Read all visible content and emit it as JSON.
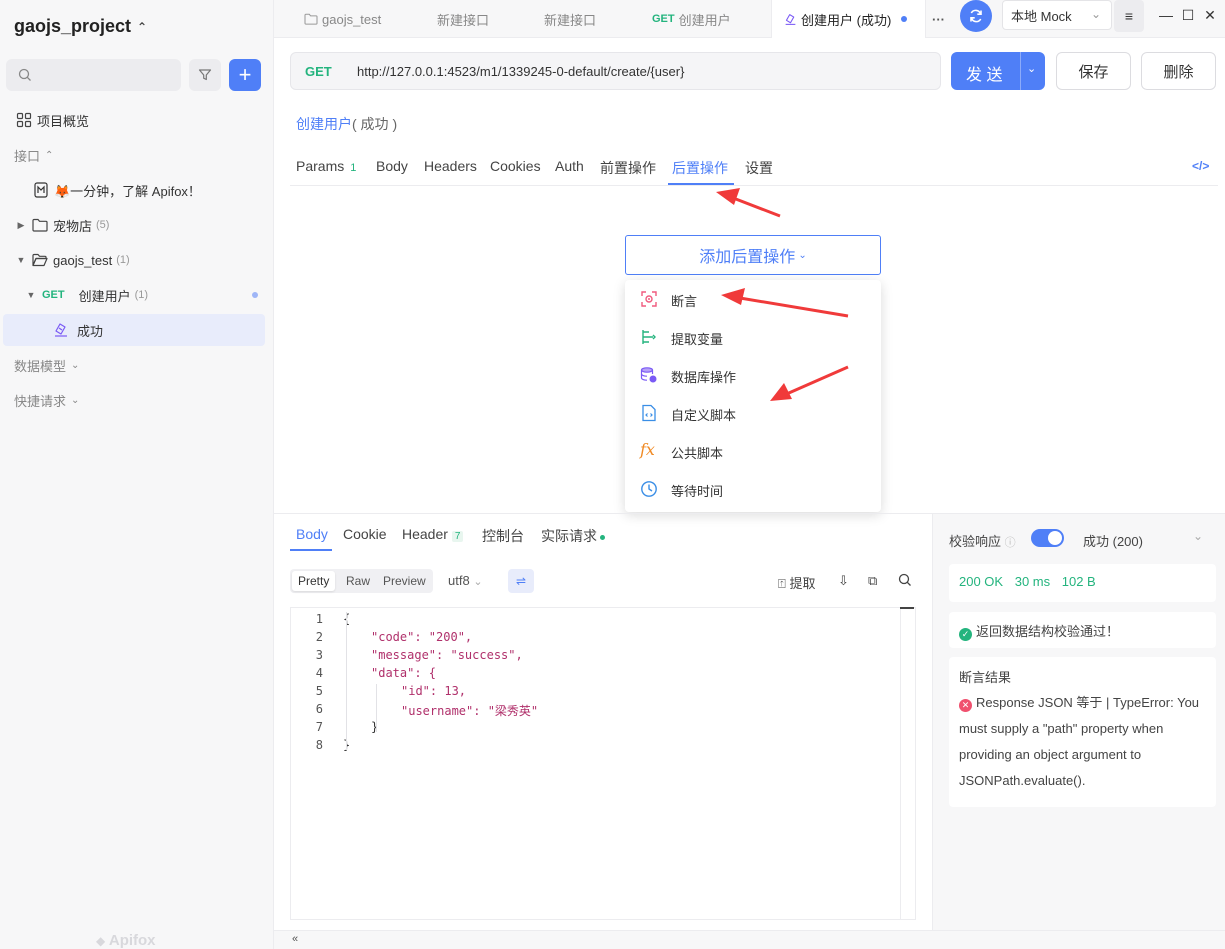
{
  "project": {
    "name": "gaojs_project",
    "switch_icon": "chevron-up-down"
  },
  "sidebar": {
    "overview": "项目概览",
    "section_api": "接口",
    "intro_item": "🦊一分钟，了解 Apifox！",
    "folders": [
      {
        "name": "宠物店",
        "count": "(5)"
      },
      {
        "name": "gaojs_test",
        "count": "(1)"
      }
    ],
    "endpoint": {
      "method": "GET",
      "name": "创建用户",
      "count": "(1)"
    },
    "case": "成功",
    "section_models": "数据模型",
    "section_quick": "快捷请求",
    "brand": "Apifox"
  },
  "tabs": [
    {
      "label": "gaojs_test",
      "icon": "folder-icon"
    },
    {
      "label": "新建接口"
    },
    {
      "label": "新建接口"
    },
    {
      "method": "GET",
      "label": "创建用户"
    },
    {
      "label": "创建用户 (成功)",
      "active": true
    }
  ],
  "tabbar": {
    "more": "···",
    "env": "本地 Mock"
  },
  "request": {
    "method": "GET",
    "url": "http://127.0.0.1:4523/m1/1339245-0-default/create/{user}",
    "send": "发 送",
    "save": "保存",
    "delete": "删除",
    "breadcrumb_name": "创建用户",
    "breadcrumb_status": "( 成功 )"
  },
  "request_tabs": [
    {
      "label": "Params",
      "count": "1"
    },
    {
      "label": "Body"
    },
    {
      "label": "Headers"
    },
    {
      "label": "Cookies"
    },
    {
      "label": "Auth"
    },
    {
      "label": "前置操作"
    },
    {
      "label": "后置操作",
      "active": true
    },
    {
      "label": "设置"
    }
  ],
  "post_ops": {
    "add_button": "添加后置操作",
    "menu": [
      {
        "label": "断言",
        "icon": "assert-icon"
      },
      {
        "label": "提取变量",
        "icon": "extract-variable-icon"
      },
      {
        "label": "数据库操作",
        "icon": "database-icon"
      },
      {
        "label": "自定义脚本",
        "icon": "script-file-icon"
      },
      {
        "label": "公共脚本",
        "icon": "fx-icon"
      },
      {
        "label": "等待时间",
        "icon": "clock-icon"
      }
    ]
  },
  "response": {
    "tabs": [
      {
        "label": "Body",
        "active": true
      },
      {
        "label": "Cookie"
      },
      {
        "label": "Header",
        "count": "7"
      },
      {
        "label": "控制台"
      },
      {
        "label": "实际请求"
      }
    ],
    "view_modes": [
      "Pretty",
      "Raw",
      "Preview"
    ],
    "encoding": "utf8",
    "extract": "提取",
    "body_lines": [
      "{",
      "\"code\": \"200\",",
      "\"message\": \"success\",",
      "\"data\": {",
      "\"id\": 13,",
      "\"username\": \"梁秀英\"",
      "}",
      "}"
    ],
    "line_numbers": [
      "1",
      "2",
      "3",
      "4",
      "5",
      "6",
      "7",
      "8"
    ]
  },
  "validation": {
    "label": "校验响应",
    "enabled": true,
    "case": "成功 (200)",
    "status": "200 OK",
    "time": "30 ms",
    "size": "102 B",
    "schema_ok": "返回数据结构校验通过！",
    "assert_title": "断言结果",
    "assert_error": "Response JSON 等于 | TypeError: You must supply a \"path\" property when providing an object argument to JSONPath.evaluate()."
  },
  "colors": {
    "accent": "#4f7ff7",
    "get": "#24b47e",
    "error": "#f0506e",
    "arrow": "#f03a3a"
  }
}
